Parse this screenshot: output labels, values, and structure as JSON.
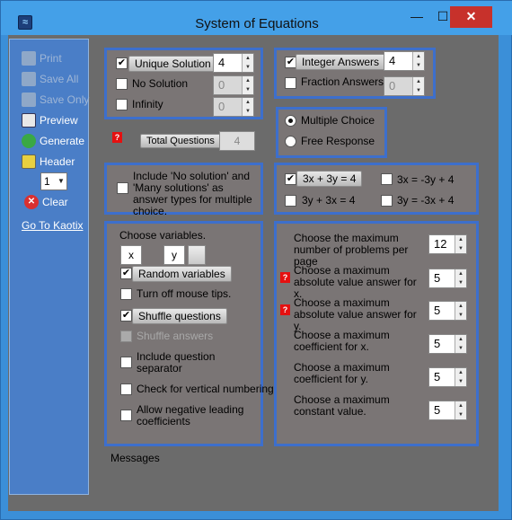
{
  "window": {
    "title": "System of Equations",
    "min_glyph": "—",
    "max_glyph": "☐",
    "close_glyph": "✕"
  },
  "sidebar": {
    "items": [
      {
        "label": "Print",
        "icon": "printer-icon",
        "enabled": false
      },
      {
        "label": "Save All",
        "icon": "save-icon",
        "enabled": false
      },
      {
        "label": "Save Only",
        "icon": "save-icon",
        "enabled": false
      },
      {
        "label": "Preview",
        "icon": "preview-icon",
        "enabled": true
      },
      {
        "label": "Generate",
        "icon": "generate-icon",
        "enabled": true
      },
      {
        "label": "Header",
        "icon": "header-icon",
        "enabled": true
      }
    ],
    "header_select_value": "1",
    "clear_label": "Clear",
    "link_label": "Go To Kaotix"
  },
  "solution_panel": {
    "unique": {
      "label": "Unique Solution",
      "checked": true,
      "value": "4"
    },
    "none": {
      "label": "No Solution",
      "checked": false,
      "value": "0"
    },
    "infinity": {
      "label": "Infinity",
      "checked": false,
      "value": "0"
    }
  },
  "total_questions": {
    "label": "Total Questions",
    "value": "4"
  },
  "answers_panel": {
    "integer": {
      "label": "Integer Answers",
      "checked": true,
      "value": "4"
    },
    "fraction": {
      "label": "Fraction Answers",
      "checked": false,
      "value": "0"
    }
  },
  "format_panel": {
    "multiple_choice": {
      "label": "Multiple Choice",
      "selected": true
    },
    "free_response": {
      "label": "Free Response",
      "selected": false
    }
  },
  "include_panel": {
    "label": "Include 'No solution' and 'Many solutions' as answer types for multiple choice.",
    "checked": false
  },
  "forms_panel": {
    "options": [
      {
        "label": "3x + 3y = 4",
        "checked": true
      },
      {
        "label": "3x = -3y + 4",
        "checked": false
      },
      {
        "label": "3y + 3x = 4",
        "checked": false
      },
      {
        "label": "3y = -3x + 4",
        "checked": false
      }
    ]
  },
  "variables_panel": {
    "heading": "Choose variables.",
    "var1": "x",
    "var2": "y",
    "random": {
      "label": "Random variables",
      "checked": true
    },
    "mouse_tips": {
      "label": "Turn off mouse tips.",
      "checked": false
    },
    "shuffle_q": {
      "label": "Shuffle questions",
      "checked": true
    },
    "shuffle_a": {
      "label": "Shuffle answers",
      "checked": false
    },
    "separator": {
      "label": "Include question separator",
      "checked": false
    },
    "vertical": {
      "label": "Check for vertical numbering",
      "checked": false
    },
    "negative": {
      "label": "Allow negative leading coefficients",
      "checked": false
    }
  },
  "max_panel": {
    "rows": [
      {
        "label": "Choose the maximum number of problems per page",
        "value": "12"
      },
      {
        "label": "Choose a  maximum absolute value answer for x.",
        "value": "5"
      },
      {
        "label": "Choose a  maximum absolute value answer for y.",
        "value": "5"
      },
      {
        "label": "Choose a maximum coefficient for x.",
        "value": "5"
      },
      {
        "label": "Choose a maximum coefficient for y.",
        "value": "5"
      },
      {
        "label": "Choose a maximum constant value.",
        "value": "5"
      }
    ]
  },
  "messages_label": "Messages",
  "colors": {
    "panel_border": "#3d6fcc",
    "sidebar_bg": "#4a7ec7",
    "warning_marker": "#e51010"
  }
}
